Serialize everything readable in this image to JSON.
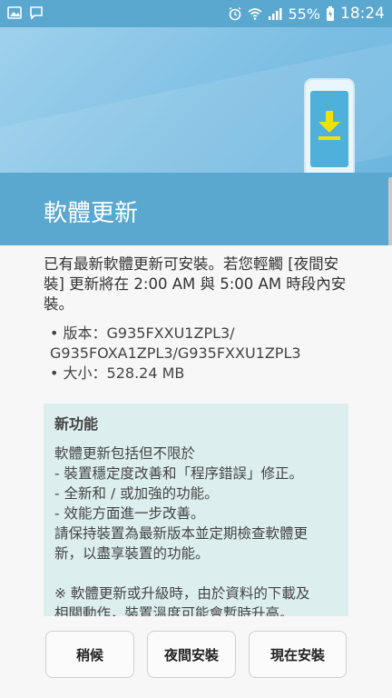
{
  "status_bar": {
    "battery": "55%",
    "time": "18:24",
    "icons_left": [
      "gallery-icon",
      "notification-icon"
    ],
    "icons_right": [
      "alarm-icon",
      "wifi-icon",
      "signal-icon",
      "battery-icon"
    ]
  },
  "header": {
    "title": "軟體更新"
  },
  "content": {
    "desc_line1": "已有最新軟體更新可安裝。若您輕觸 [夜間安",
    "desc_line2": "裝] 更新將在 2:00 AM 與 5:00 AM 時段內安",
    "desc_line3": "裝。",
    "version_line1": "• 版本：G935FXXU1ZPL3/",
    "version_line2": "G935FOXA1ZPL3/G935FXXU1ZPL3",
    "size_line": "• 大小：528.24 MB",
    "panel": {
      "title": "新功能",
      "lines": [
        "軟體更新包括但不限於",
        "- 裝置穩定度改善和「程序錯誤」修正。",
        "- 全新和 / 或加強的功能。",
        "- 效能方面進一步改善。",
        "請保持裝置為最新版本並定期檢查軟體更",
        "新，以盡享裝置的功能。"
      ],
      "note_lines": [
        "※ 軟體更新或升級時，由於資料的下載及",
        "相關動作，裝置溫度可能會暫時升高。"
      ]
    }
  },
  "buttons": {
    "later": "稍候",
    "overnight": "夜間安裝",
    "now": "現在安裝"
  },
  "colors": {
    "accent": "#5aa7cf",
    "panel_bg": "#ddeeee",
    "download_arrow": "#f1e10b"
  }
}
